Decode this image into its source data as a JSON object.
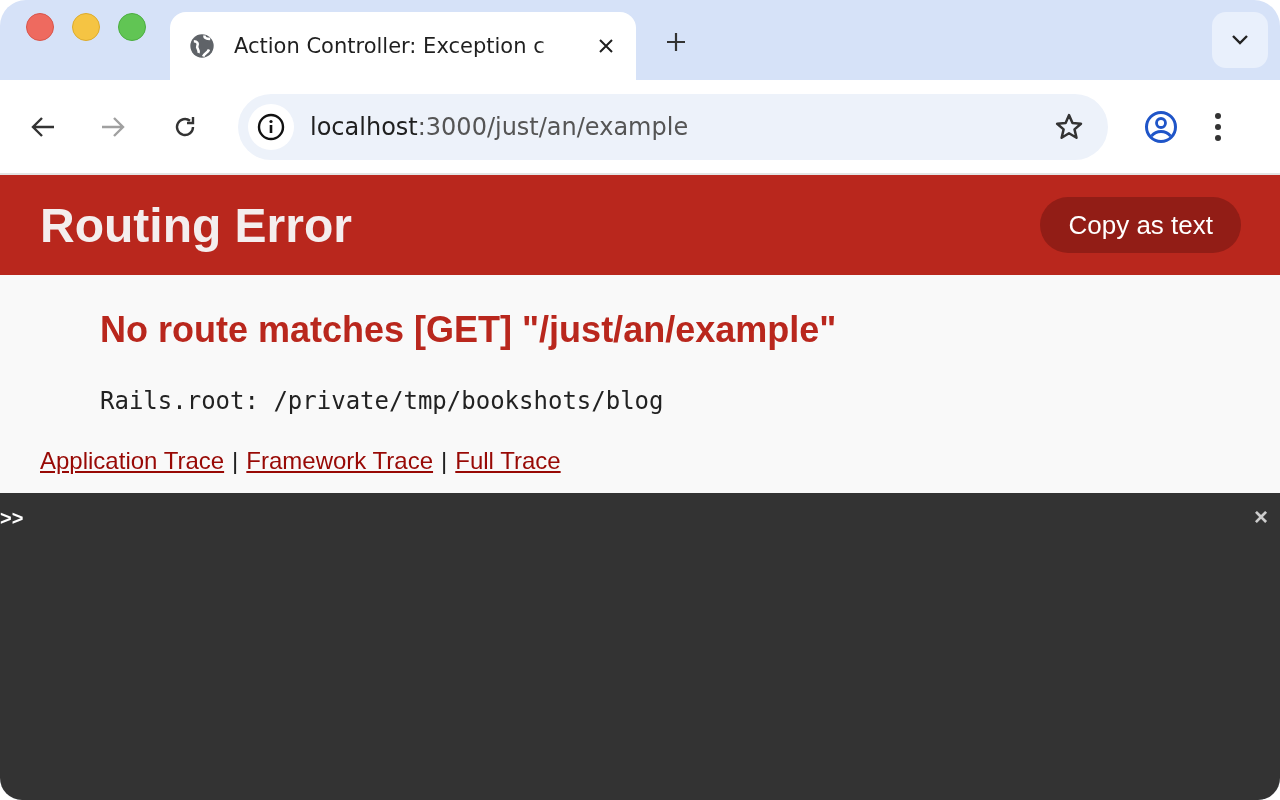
{
  "browser": {
    "tab": {
      "title": "Action Controller: Exception c",
      "selected": true
    },
    "address": {
      "host": "localhost",
      "path": ":3000/just/an/example"
    }
  },
  "header": {
    "title": "Routing Error",
    "copy_button": "Copy as text"
  },
  "error": {
    "message": "No route matches [GET] \"/just/an/example\"",
    "root": "Rails.root: /private/tmp/bookshots/blog"
  },
  "trace_links": [
    {
      "label": "Application Trace"
    },
    {
      "label": "Framework Trace"
    },
    {
      "label": "Full Trace"
    }
  ],
  "separator": "|",
  "console": {
    "prompt": ">>",
    "close": "×"
  }
}
